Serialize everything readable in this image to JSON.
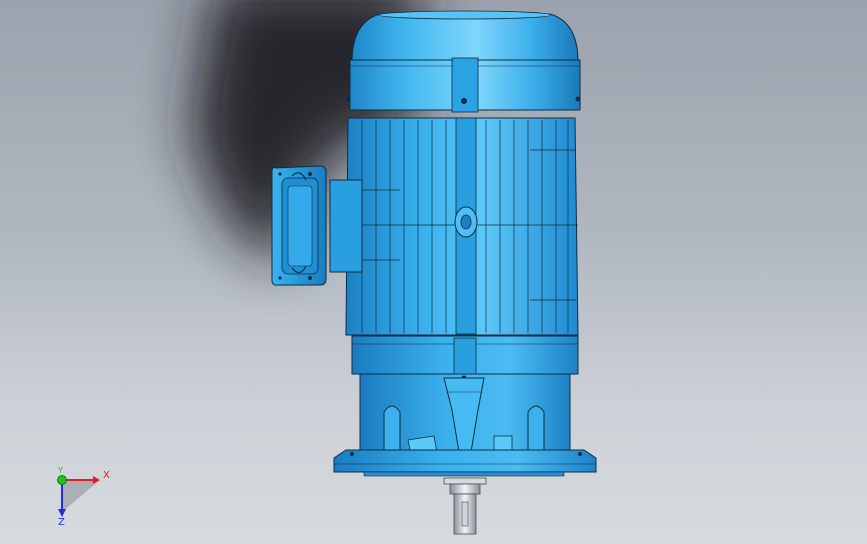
{
  "viewport": {
    "background_top": "#9ca2ad",
    "background_bottom": "#d7dade",
    "shadow_color": "#1a1c20"
  },
  "model": {
    "body_color": "#2aa6e6",
    "body_highlight": "#6fd0fa",
    "body_dark": "#1578b8",
    "edge_color": "#0d2d45"
  },
  "triad": {
    "x_label": "X",
    "y_label": "Y",
    "z_label": "Z",
    "x_color": "#e02020",
    "y_color": "#20c020",
    "z_color": "#2030e0"
  }
}
